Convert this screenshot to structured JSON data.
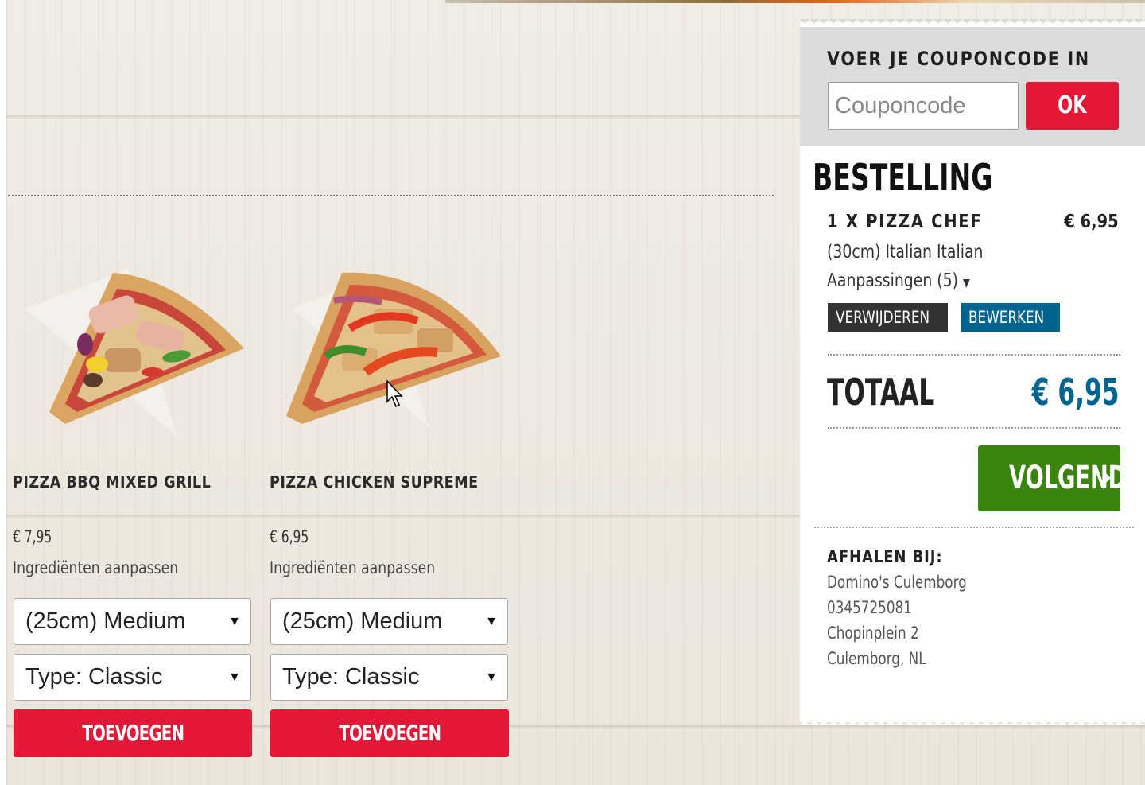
{
  "products": [
    {
      "name": "PIZZA BBQ MIXED GRILL",
      "price": "€ 7,95",
      "customize_label": "Ingrediënten aanpassen",
      "size_value": "(25cm) Medium",
      "type_value": "Type: Classic",
      "add_label": "TOEVOEGEN"
    },
    {
      "name": "PIZZA CHICKEN SUPREME",
      "price": "€ 6,95",
      "customize_label": "Ingrediënten aanpassen",
      "size_value": "(25cm) Medium",
      "type_value": "Type: Classic",
      "add_label": "TOEVOEGEN"
    }
  ],
  "coupon": {
    "title": "VOER JE COUPONCODE IN",
    "placeholder": "Couponcode",
    "ok_label": "OK"
  },
  "order": {
    "title": "BESTELLING",
    "items": [
      {
        "name": "1 X PIZZA CHEF",
        "price": "€ 6,95",
        "details": "(30cm) Italian Italian",
        "adjustments": "Aanpassingen (5)",
        "remove_label": "VERWIJDEREN",
        "edit_label": "BEWERKEN"
      }
    ],
    "total_label": "TOTAAL",
    "total_value": "€ 6,95",
    "next_label": "VOLGENDE"
  },
  "pickup": {
    "title": "AFHALEN BIJ:",
    "store": "Domino's Culemborg",
    "phone": "0345725081",
    "street": "Chopinplein 2",
    "city": "Culemborg, NL"
  },
  "colors": {
    "brand_red": "#e31837",
    "brand_blue": "#006491",
    "next_green": "#3c8410"
  },
  "icons": {
    "dropdown": "caret-down-icon",
    "next": "chevron-right-icon",
    "cursor": "mouse-pointer-icon"
  }
}
